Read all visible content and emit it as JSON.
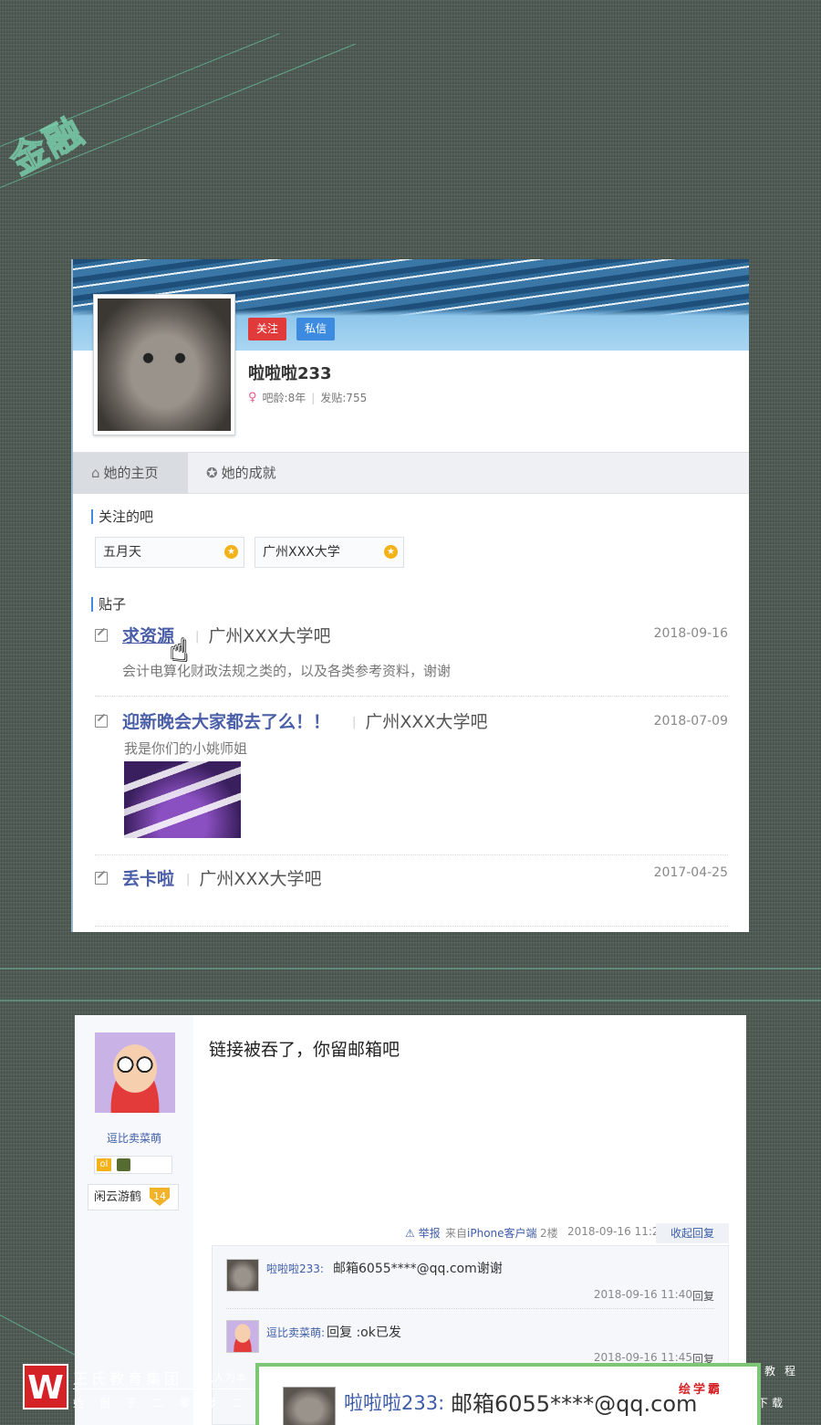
{
  "decor": {
    "finance_text": "金融"
  },
  "profile": {
    "follow_label": "关注",
    "message_label": "私信",
    "username": "啦啦啦233",
    "age": "吧龄:8年",
    "posts": "发贴:755",
    "tabs": [
      {
        "label": "她的主页"
      },
      {
        "label": "她的成就"
      }
    ],
    "followed_bars_title": "关注的吧",
    "followed_bars": [
      {
        "name": "五月天"
      },
      {
        "name": "广州XXX大学"
      }
    ],
    "posts_title": "贴子",
    "post_list": [
      {
        "title": "求资源",
        "bar": "广州XXX大学吧",
        "date": "2018-09-16",
        "excerpt": "会计电算化财政法规之类的，以及各类参考资料，谢谢"
      },
      {
        "title": "迎新晚会大家都去了么！！",
        "bar": "广州XXX大学吧",
        "date": "2018-07-09",
        "excerpt": "我是你们的小姚师姐"
      },
      {
        "title": "丢卡啦",
        "bar": "广州XXX大学吧",
        "date": "2017-04-25"
      }
    ]
  },
  "reply": {
    "username": "逗比卖菜萌",
    "badge_letter": "ol",
    "level_name": "闲云游鹤",
    "level_num": "14",
    "content": "链接被吞了，你留邮箱吧",
    "report": "举报",
    "from_prefix": "来自",
    "from_client": "iPhone客户端",
    "floor": "2楼",
    "time": "2018-09-16 11:25",
    "collapse": "收起回复",
    "subreplies": [
      {
        "name": "啦啦啦233:",
        "text": "邮箱6055****@qq.com谢谢",
        "time": "2018-09-16 11:40",
        "reply": "回复"
      },
      {
        "name": "逗比卖菜萌:",
        "text": "回复 :ok已发",
        "time": "2018-09-16 11:45",
        "reply": "回复"
      }
    ]
  },
  "footer": {
    "logo_letter": "W",
    "org": "王氏教育集团",
    "slogan": "以人为本",
    "since": "始创于二零零二年",
    "right_top": "教程",
    "right_bottom": "下载"
  },
  "zoom": {
    "name": "啦啦啦233:",
    "text": "邮箱6055****@qq.com",
    "brand": "绘学霸"
  }
}
